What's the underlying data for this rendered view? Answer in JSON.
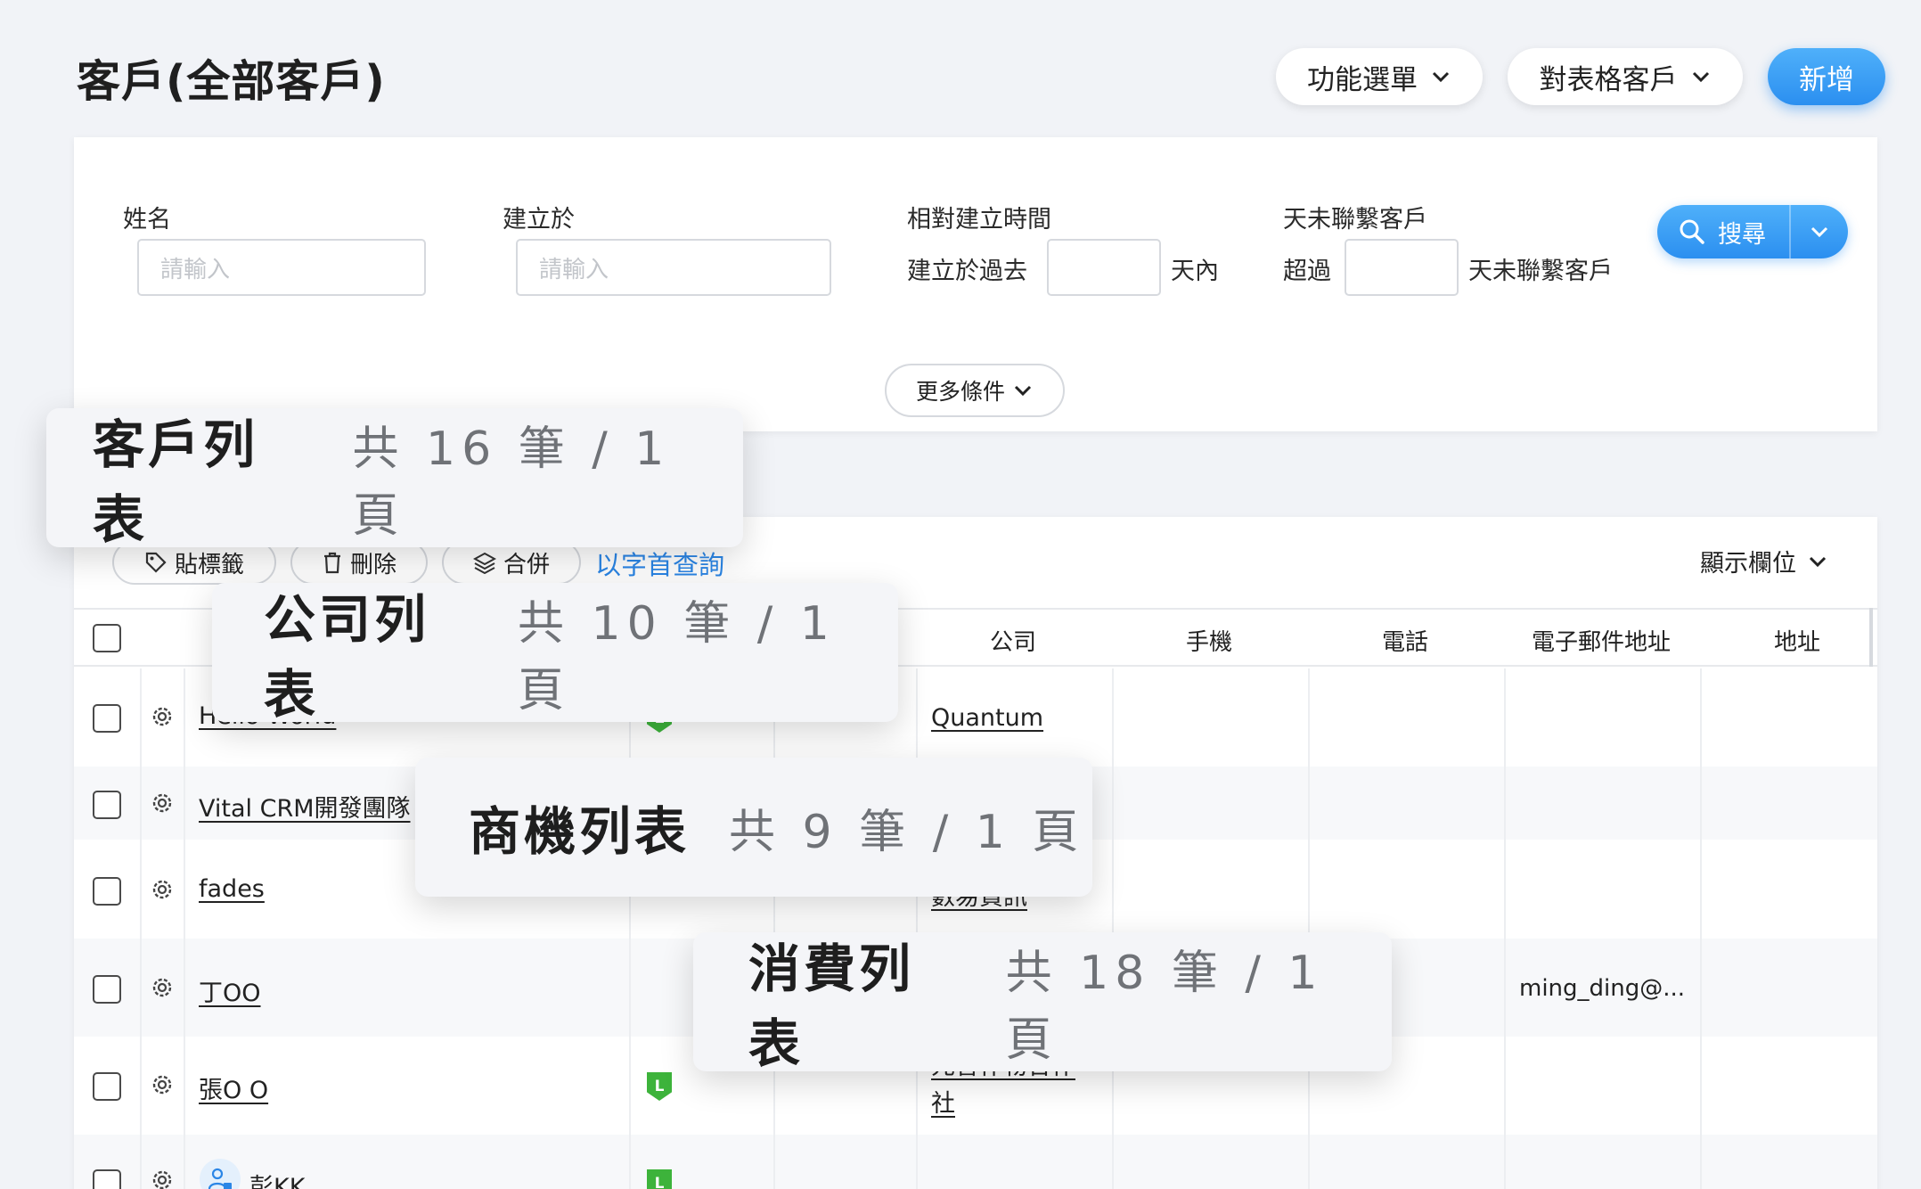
{
  "header": {
    "title": "客戶(全部客戶)",
    "menu_button": "功能選單",
    "table_button": "對表格客戶",
    "add_button": "新增"
  },
  "filters": {
    "name_label": "姓名",
    "name_placeholder": "請輸入",
    "created_label": "建立於",
    "created_placeholder": "請輸入",
    "relative_label": "相對建立時間",
    "relative_prefix": "建立於過去",
    "relative_suffix": "天內",
    "uncontacted_label": "天未聯繫客戶",
    "uncontacted_prefix": "超過",
    "uncontacted_suffix": "天未聯繫客戶",
    "search_button": "搜尋",
    "more_button": "更多條件"
  },
  "toolbar": {
    "tag_button": "貼標籤",
    "delete_button": "刪除",
    "merge_button": "合併",
    "initial_search_link": "以字首查詢",
    "columns_button": "顯示欄位"
  },
  "table": {
    "columns": [
      "公司",
      "手機",
      "電話",
      "電子郵件地址",
      "地址"
    ],
    "rows": [
      {
        "name": "Hello World",
        "company": "Quantum"
      },
      {
        "name": "Vital CRM開發團隊",
        "company": ""
      },
      {
        "name": "fades",
        "company": "數易資訊"
      },
      {
        "name": "丁OO",
        "company": "",
        "email": "ming_ding@..."
      },
      {
        "name": "張O O",
        "company": "元智作物合作社"
      },
      {
        "name": "彭KK",
        "company": ""
      }
    ]
  },
  "overlays": [
    {
      "title": "客戶列表",
      "count": "共 16 筆 / 1 頁"
    },
    {
      "title": "公司列表",
      "count": "共 10 筆 / 1 頁"
    },
    {
      "title": "商機列表",
      "count": "共 9 筆 / 1 頁"
    },
    {
      "title": "消費列表",
      "count": "共 18 筆 / 1 頁"
    }
  ],
  "colors": {
    "primary": "#2b8ff0",
    "link": "#2b86e6",
    "line_badge": "#3db33b",
    "background": "#f1f3f7"
  }
}
